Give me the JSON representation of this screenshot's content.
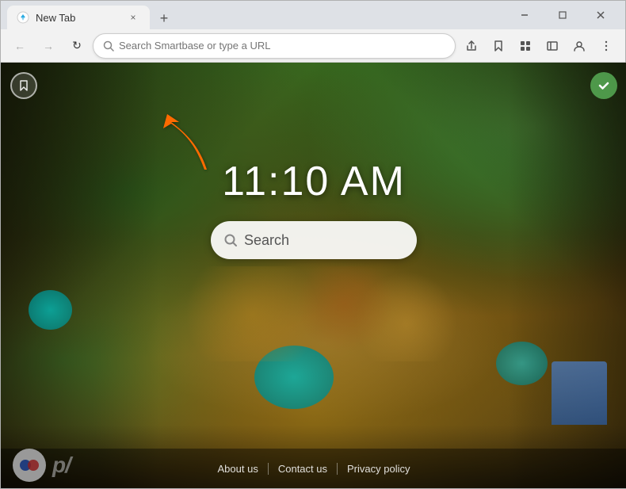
{
  "window": {
    "title": "New Tab",
    "close_label": "×",
    "minimize_label": "—",
    "maximize_label": "□"
  },
  "tab": {
    "label": "New Tab",
    "new_tab_btn": "+"
  },
  "toolbar": {
    "back_label": "←",
    "forward_label": "→",
    "refresh_label": "↻",
    "address_placeholder": "Search Smartbase or type a URL",
    "share_icon": "⬆",
    "bookmark_icon": "☆",
    "extensions_icon": "🧩",
    "sidebar_icon": "▭",
    "profile_icon": "👤",
    "menu_icon": "⋮"
  },
  "new_tab": {
    "time": "11:10 AM",
    "search_placeholder": "Search"
  },
  "footer": {
    "links": [
      "About us",
      "Contact us",
      "Privacy policy"
    ]
  },
  "annotation": {
    "arrow_color": "#FF6B00"
  },
  "logo": {
    "text": "p",
    "dot_color": "#e83030",
    "letter_color": "#2255cc"
  }
}
